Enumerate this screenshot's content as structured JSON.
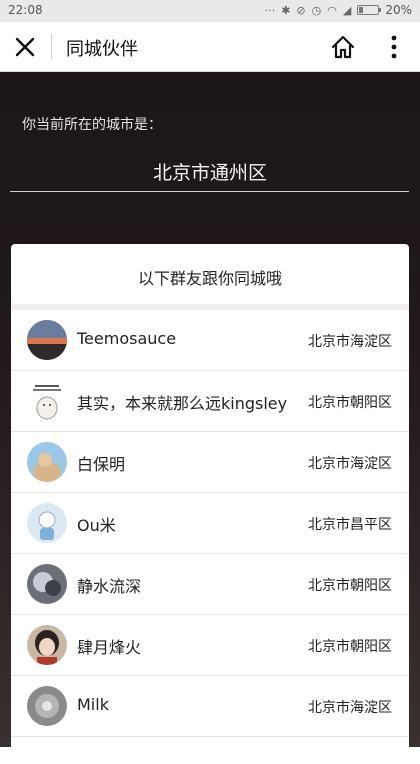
{
  "status_bar": {
    "time": "22:08",
    "battery": "20%",
    "battery_level": 0.2
  },
  "title_bar": {
    "title": "同城伙伴"
  },
  "hero": {
    "prompt": "你当前所在的城市是：",
    "city": "北京市通州区"
  },
  "list": {
    "header": "以下群友跟你同城哦",
    "items": [
      {
        "name": "Teemosauce",
        "region": "北京市海淀区"
      },
      {
        "name": "其实，本来就那么远kingsley",
        "region": "北京市朝阳区"
      },
      {
        "name": "白保明",
        "region": "北京市海淀区"
      },
      {
        "name": "Ou米",
        "region": "北京市昌平区"
      },
      {
        "name": "静水流深",
        "region": "北京市朝阳区"
      },
      {
        "name": "肆月烽火",
        "region": "北京市朝阳区"
      },
      {
        "name": "Milk",
        "region": "北京市海淀区"
      }
    ]
  }
}
